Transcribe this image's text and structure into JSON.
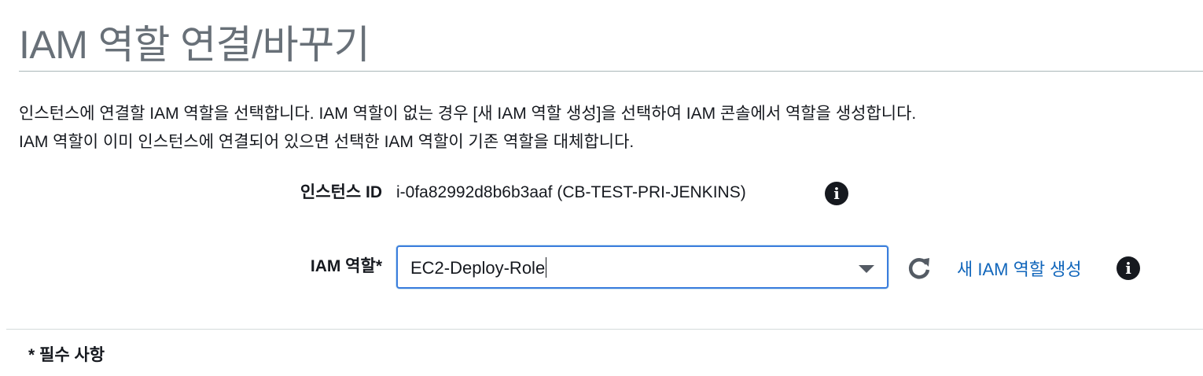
{
  "page": {
    "title": "IAM 역할 연결/바꾸기",
    "description_line1": "인스턴스에 연결할 IAM 역할을 선택합니다. IAM 역할이 없는 경우 [새 IAM 역할 생성]을 선택하여 IAM 콘솔에서 역할을 생성합니다.",
    "description_line2": "IAM 역할이 이미 인스턴스에 연결되어 있으면 선택한 IAM 역할이 기존 역할을 대체합니다."
  },
  "form": {
    "instance_label": "인스턴스 ID",
    "instance_value": "i-0fa82992d8b6b3aaf (CB-TEST-PRI-JENKINS)",
    "role_label": "IAM 역할*",
    "role_value": "EC2-Deploy-Role",
    "create_role_link": "새 IAM 역할 생성",
    "info_icon_glyph": "i"
  },
  "footer": {
    "required_note": "* 필수 사항"
  },
  "icons": {
    "info": "info-icon",
    "refresh": "refresh-icon",
    "dropdown": "caret-down-icon"
  },
  "colors": {
    "title": "#687078",
    "link": "#1166bb",
    "focus_border": "#3b7ddd",
    "text": "#16191f"
  }
}
